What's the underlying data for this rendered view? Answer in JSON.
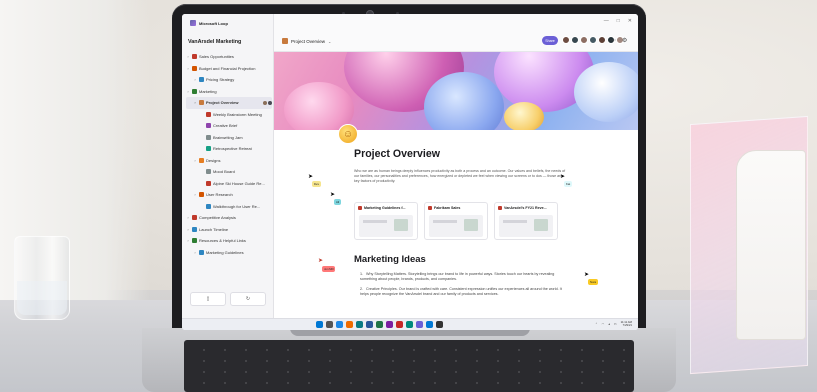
{
  "app": {
    "name": "Microsoft Loop"
  },
  "sidebar": {
    "workspace": "VanArsdel Marketing",
    "items": [
      {
        "label": "Sales Opportunities",
        "level": 0,
        "icon": "folder-icon",
        "color": "#c0392b"
      },
      {
        "label": "Budget and Financial Projection",
        "level": 0,
        "icon": "page-icon",
        "color": "#d35400"
      },
      {
        "label": "Pricing Strategy",
        "level": 1,
        "icon": "page-icon",
        "color": "#2e86c1"
      },
      {
        "label": "Marketing",
        "level": 0,
        "icon": "target-icon",
        "color": "#2e7d32"
      },
      {
        "label": "Project Overview",
        "level": 1,
        "icon": "page-icon",
        "color": "#c87a3d",
        "active": true
      },
      {
        "label": "Weekly Brainstorm Meeting",
        "level": 2,
        "icon": "page-icon",
        "color": "#c0392b"
      },
      {
        "label": "Creative Brief",
        "level": 2,
        "icon": "page-icon",
        "color": "#8e44ad"
      },
      {
        "label": "Brainwriting Jam",
        "level": 2,
        "icon": "pencil-icon",
        "color": "#7f8c8d"
      },
      {
        "label": "Retrospective Retreat",
        "level": 2,
        "icon": "page-icon",
        "color": "#16a085"
      },
      {
        "label": "Designs",
        "level": 1,
        "icon": "palette-icon",
        "color": "#e67e22"
      },
      {
        "label": "Mood Board",
        "level": 2,
        "icon": "pencil-icon",
        "color": "#7f8c8d"
      },
      {
        "label": "Alpine Ski House Guide Re...",
        "level": 2,
        "icon": "page-icon",
        "color": "#c0392b"
      },
      {
        "label": "User Research",
        "level": 1,
        "icon": "page-icon",
        "color": "#d35400"
      },
      {
        "label": "Walkthrough for User Re...",
        "level": 2,
        "icon": "page-icon",
        "color": "#2e86c1"
      },
      {
        "label": "Competitive Analysis",
        "level": 0,
        "icon": "page-icon",
        "color": "#c0392b"
      },
      {
        "label": "Launch Timeline",
        "level": 0,
        "icon": "calendar-icon",
        "color": "#2e86c1"
      },
      {
        "label": "Resources & Helpful Links",
        "level": 0,
        "icon": "link-icon",
        "color": "#2e7d32"
      },
      {
        "label": "Marketing Guidelines",
        "level": 1,
        "icon": "page-icon",
        "color": "#2e86c1"
      }
    ]
  },
  "topbar": {
    "breadcrumb": "Project Overview",
    "share_label": "Share",
    "avatar_colors": [
      "#6d4c41",
      "#37474f",
      "#8d6e63",
      "#455a64",
      "#5d4037",
      "#263238",
      "#a1887f"
    ]
  },
  "page": {
    "title": "Project Overview",
    "intro": "Who we are as human beings deeply influences productivity as both a process and an outcome. Our values and beliefs, the needs of our families, our personalities and preferences, how energized or depleted we feel when viewing our screens or to dos — those are key factors of productivity.",
    "cards": [
      {
        "title": "Marketing Guidelines f...",
        "color": "#c0392b"
      },
      {
        "title": "Fabrikam Sales",
        "color": "#c0392b"
      },
      {
        "title": "VanArsdel's FY21 Reve...",
        "color": "#c0392b"
      }
    ],
    "section_title": "Marketing Ideas",
    "ideas": [
      "Why Storytelling Matters. Storytelling brings our brand to life in powerful ways. Stories touch our hearts by revealing something about people, brands, products, and companies.",
      "Creative Principles. Our brand is crafted with care. Consistent expression unifies our experiences all around the world. It helps people recognize the VanArsdel brand and our family of products and services."
    ]
  },
  "cursors": [
    {
      "label": "Dev",
      "color": "#f6e58d"
    },
    {
      "label": "Ali",
      "color": "#7ed6df"
    },
    {
      "label": "Kat",
      "color": "#dff9fb"
    },
    {
      "label": "Jon Mill",
      "color": "#ff7979"
    },
    {
      "label": "Nora",
      "color": "#f9ca24"
    }
  ],
  "taskbar": {
    "time": "11:11 AM",
    "date": "7/29/21",
    "app_colors": [
      "#0078d4",
      "#555555",
      "#1e88e5",
      "#ef6c00",
      "#0a7b83",
      "#2b579a",
      "#217346",
      "#7b1fa2",
      "#c62828",
      "#00897b",
      "#6b5fd6",
      "#0078d4",
      "#333333"
    ]
  }
}
